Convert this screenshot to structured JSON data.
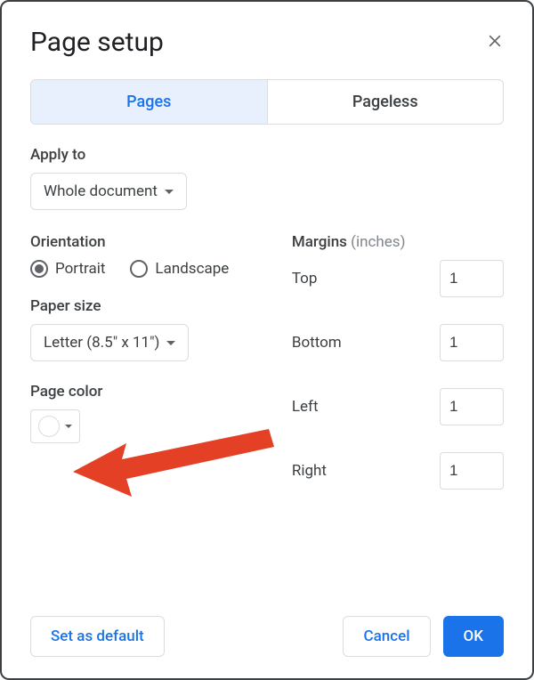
{
  "dialog": {
    "title": "Page setup"
  },
  "tabs": {
    "pages": "Pages",
    "pageless": "Pageless",
    "active": "pages"
  },
  "apply_to": {
    "label": "Apply to",
    "value": "Whole document"
  },
  "orientation": {
    "label": "Orientation",
    "portrait": "Portrait",
    "landscape": "Landscape",
    "selected": "portrait"
  },
  "paper_size": {
    "label": "Paper size",
    "value": "Letter (8.5\" x 11\")"
  },
  "page_color": {
    "label": "Page color",
    "value": "#ffffff"
  },
  "margins": {
    "label": "Margins",
    "unit": "(inches)",
    "top_label": "Top",
    "top_value": "1",
    "bottom_label": "Bottom",
    "bottom_value": "1",
    "left_label": "Left",
    "left_value": "1",
    "right_label": "Right",
    "right_value": "1"
  },
  "footer": {
    "set_default": "Set as default",
    "cancel": "Cancel",
    "ok": "OK"
  },
  "annotation": {
    "arrow_color": "#e34025"
  }
}
